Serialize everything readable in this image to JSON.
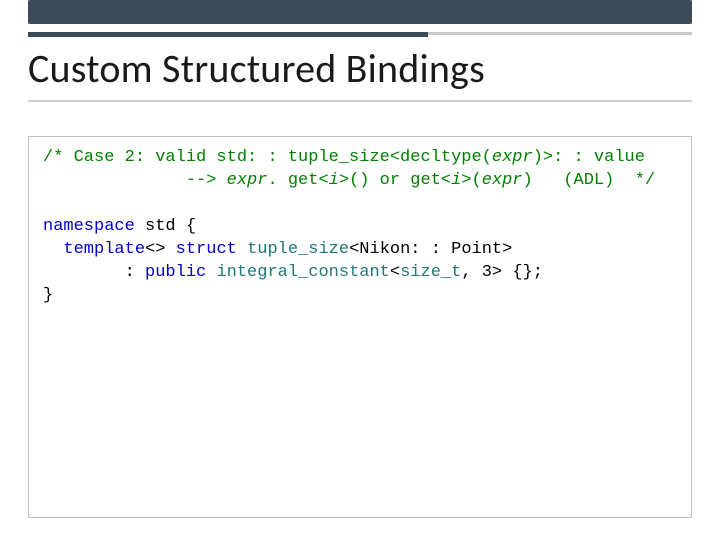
{
  "title": "Custom Structured Bindings",
  "code": {
    "comment": {
      "open": "/*",
      "l1a": " Case 2: valid std: : tuple_size<decltype(",
      "l1_expr": "expr",
      "l1b": ")>: : value",
      "l2_indent": "              ",
      "l2_dashes": "--",
      "l2_gt": "> ",
      "l2_expr": "expr",
      "l2c": ". get<",
      "l2_i1": "i",
      "l2d": ">() or get<",
      "l2_i2": "i",
      "l2e": ">(",
      "l2_expr2": "expr",
      "l2f": ")   (ADL)  ",
      "close": "*/"
    },
    "ns": {
      "kw_namespace": "namespace",
      "std": " std ",
      "brace_open": "{",
      "indent1": "  ",
      "kw_template": "template",
      "angles_empty": "<> ",
      "kw_struct": "struct",
      "sp1": " ",
      "tuple_size": "tuple_size",
      "lt1": "<",
      "nikon_point": "Nikon: : Point",
      "gt1": ">",
      "indent2": "        ",
      "colon_sp": ": ",
      "kw_public": "public",
      "sp2": " ",
      "integral_constant": "integral_constant",
      "lt2": "<",
      "size_t": "size_t",
      "comma_three": ", 3",
      "gt2": "> {};",
      "brace_close": "}"
    }
  }
}
